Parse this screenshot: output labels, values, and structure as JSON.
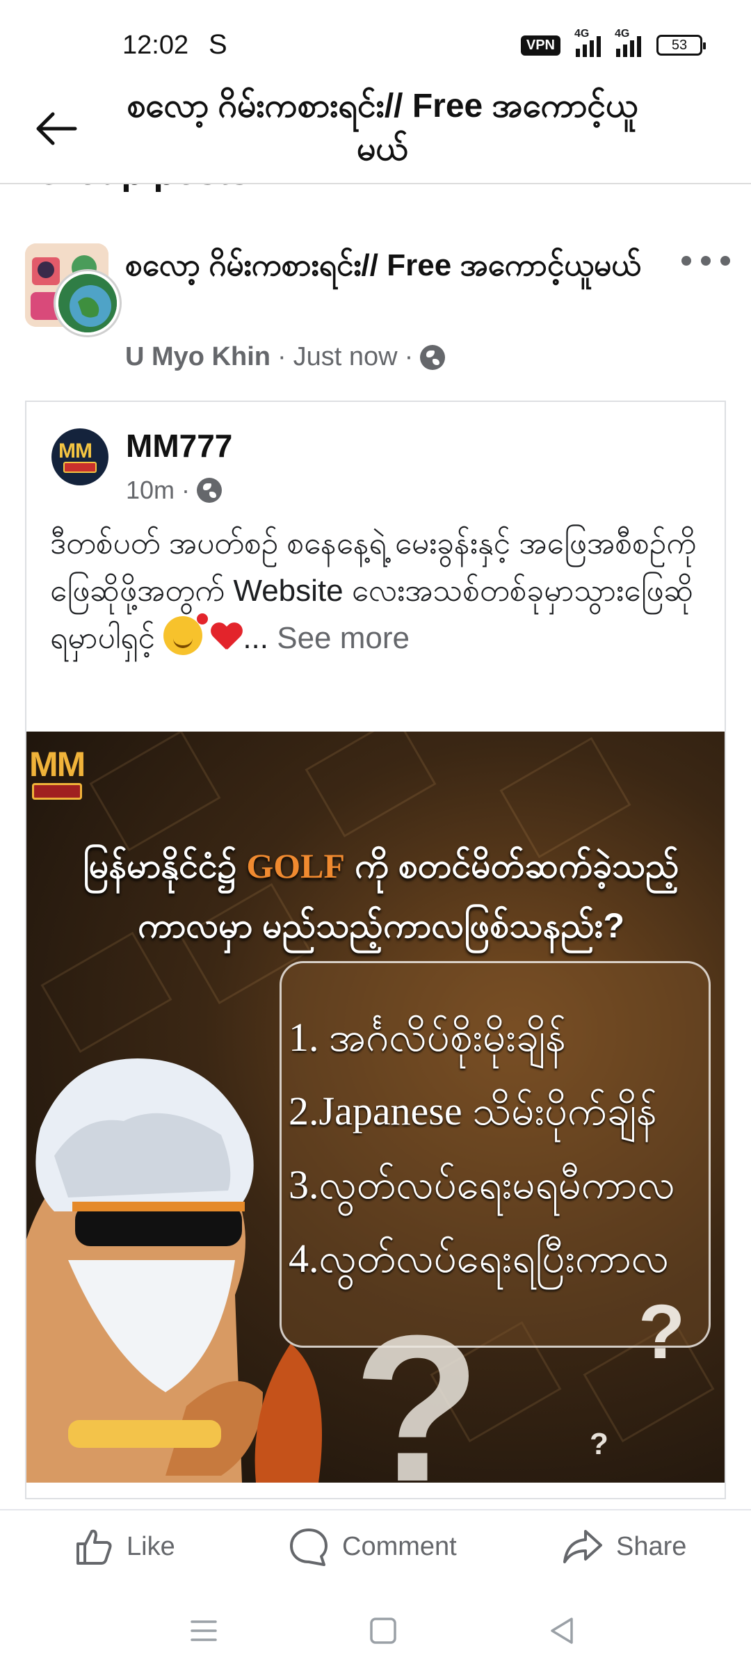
{
  "status_bar": {
    "time": "12:02",
    "carrier_icon": "S",
    "vpn": "VPN",
    "network1": "4G",
    "network2": "4G",
    "battery": "53"
  },
  "app_bar": {
    "title": "စလော့ ဂိမ်းကစားရင်း// Free အကောင့်ယူမယ်",
    "back_icon": "arrow-left-icon"
  },
  "section_peek": "Group posts",
  "post": {
    "group_name": "စလော့ ဂိမ်းကစားရင်း// Free အကောင့်ယူမယ်",
    "author": "U Myo Khin",
    "time": "Just now",
    "separator": "·",
    "more_icon": "ellipsis-icon",
    "privacy_icon": "globe-icon"
  },
  "shared": {
    "page_name": "MM777",
    "avatar_text": "MM",
    "time": "10m",
    "separator": "·",
    "text": "ဒီတစ်ပတ် အပတ်စဉ် စနေနေ့ရဲ့ မေးခွန်းနှင့် အဖြေအစီစဉ်ကို ဖြေဆိုဖို့အတွက် Website လေးအသစ်တစ်ခုမှာသွားဖြေဆိုရမှာပါရှင့် ",
    "ellipsis": "... ",
    "see_more": "See more"
  },
  "image": {
    "logo": "MM",
    "headline_part1": "မြန်မာနိုင်ငံ၌ ",
    "headline_golf": "GOLF",
    "headline_part2": " ကို စတင်မိတ်ဆက်ခဲ့သည့်ကာလမှာ မည်သည့်ကာလဖြစ်သနည်း?",
    "options": [
      "1. အင်္ဂလိပ်စိုးမိုးချိန်",
      "2.Japanese သိမ်းပိုက်ချိန်",
      "3.လွတ်လပ်ရေးမရမီကာလ",
      "4.လွတ်လပ်ရေးရပြီးကာလ"
    ],
    "question_mark": "?"
  },
  "actions": {
    "like": "Like",
    "comment": "Comment",
    "share": "Share"
  },
  "colors": {
    "secondary_text": "#65676b",
    "golf_accent": "#f08a30",
    "heart": "#e3242b"
  }
}
